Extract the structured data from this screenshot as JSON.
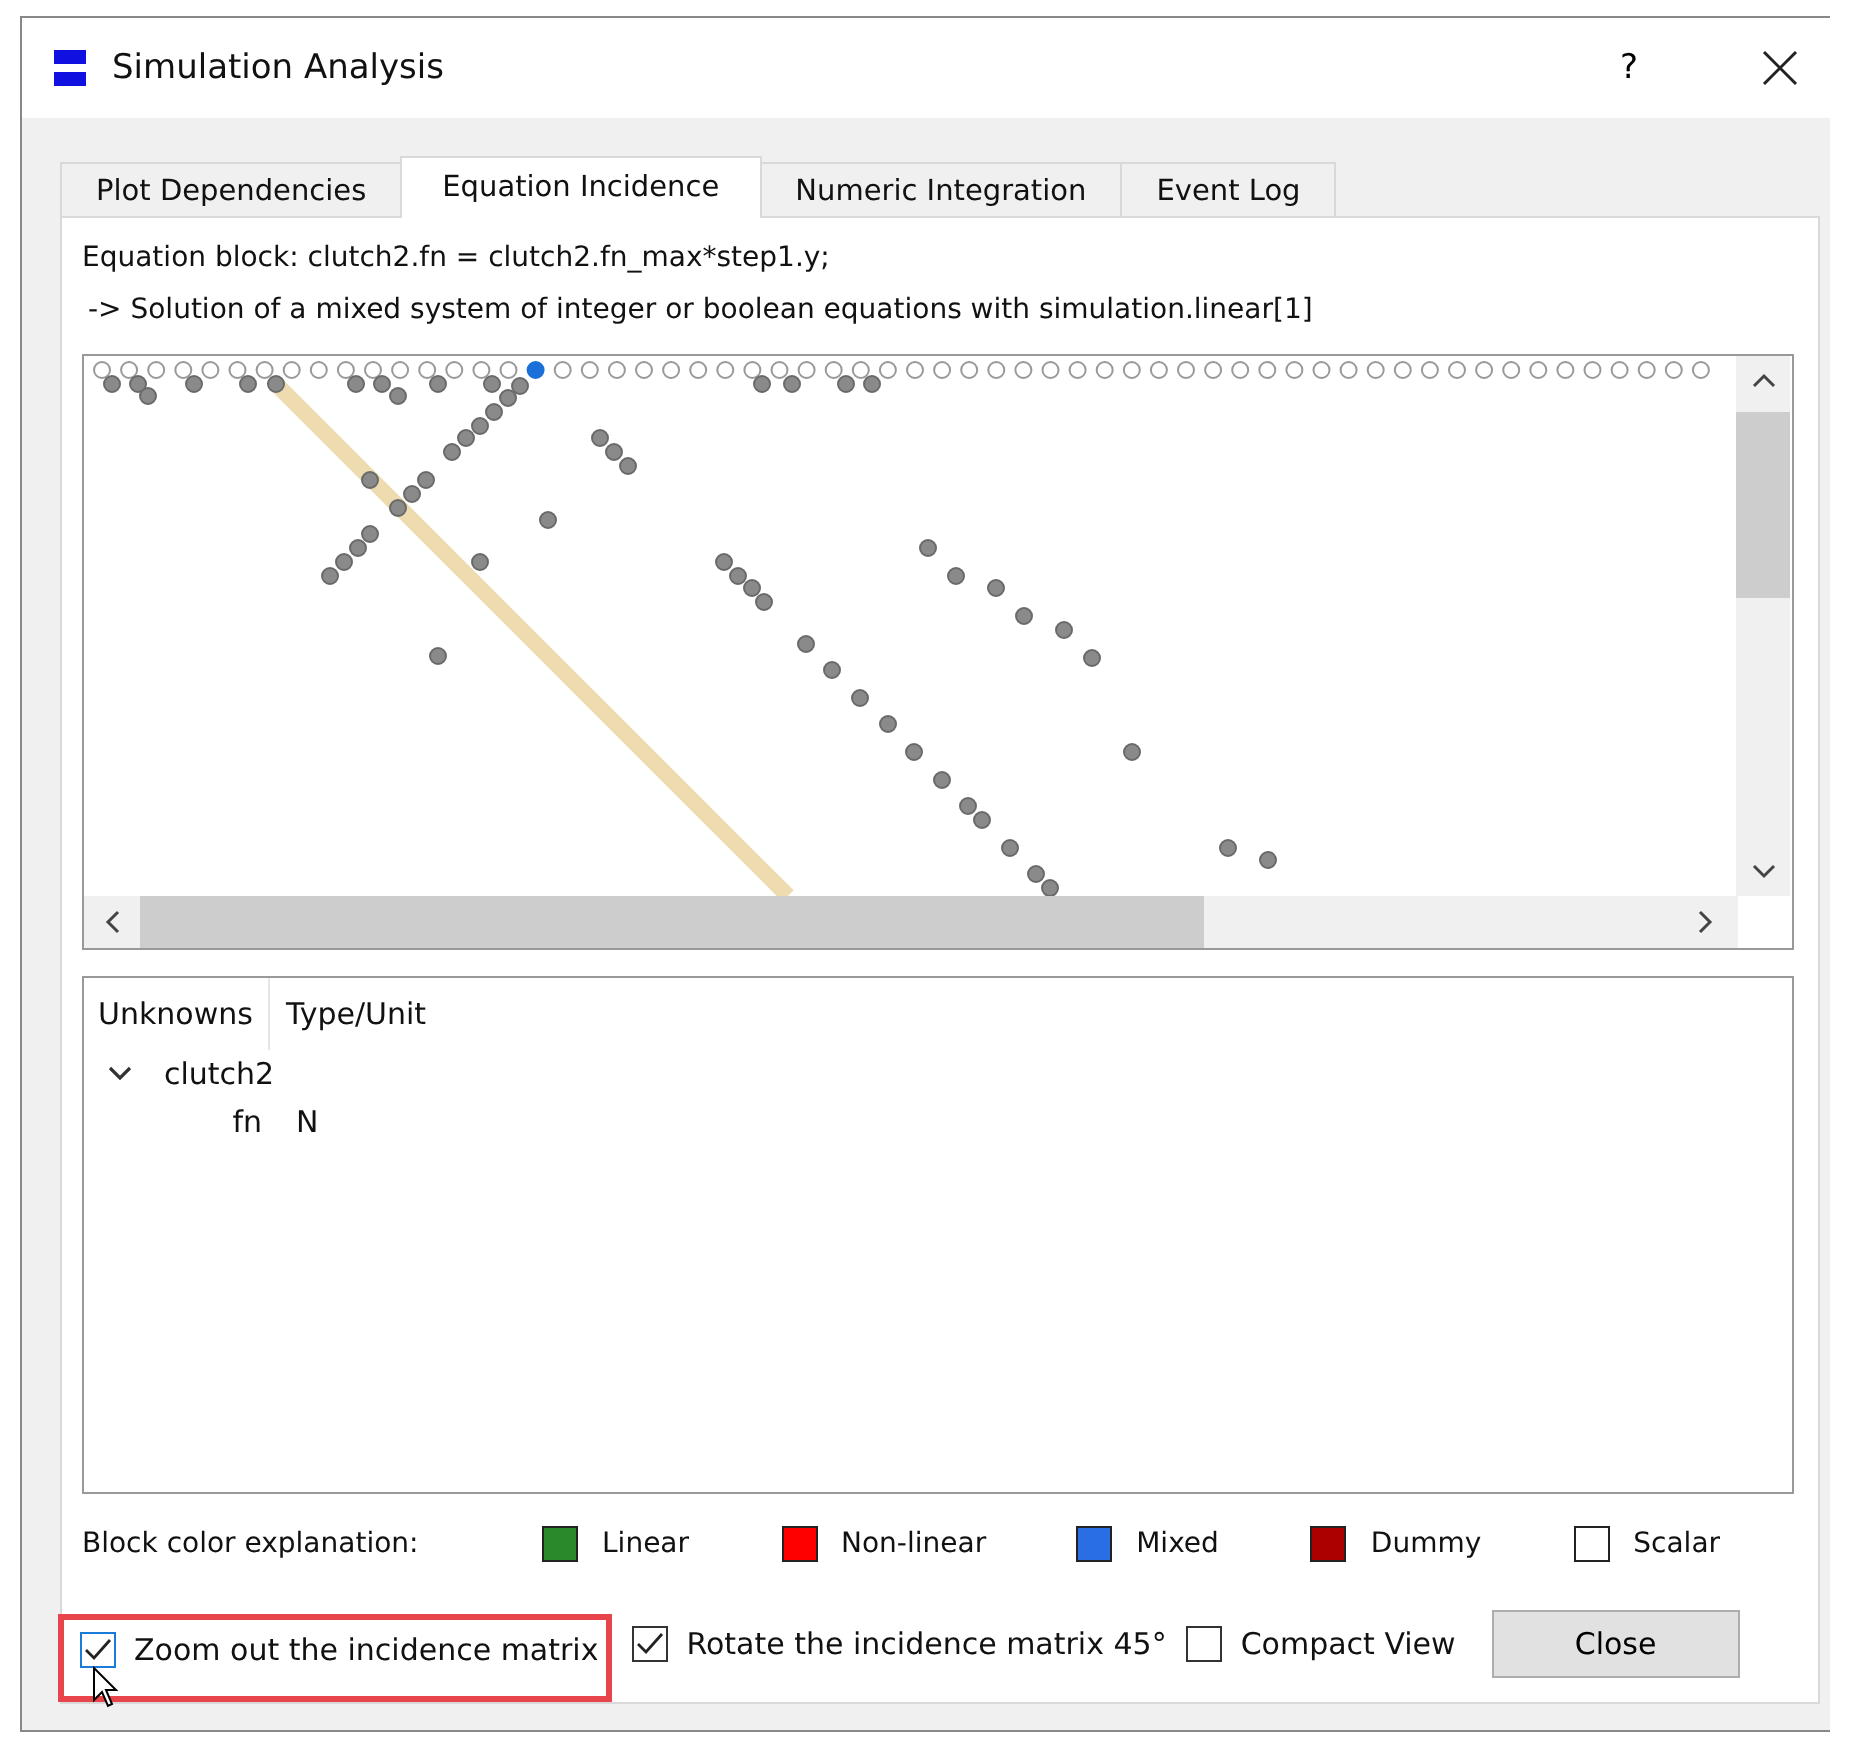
{
  "window": {
    "title": "Simulation Analysis",
    "help": "?"
  },
  "tabs": [
    {
      "label": "Plot Dependencies",
      "selected": false
    },
    {
      "label": "Equation Incidence",
      "selected": true
    },
    {
      "label": "Numeric Integration",
      "selected": false
    },
    {
      "label": "Event Log",
      "selected": false
    }
  ],
  "equation_block": "Equation block: clutch2.fn = clutch2.fn_max*step1.y;",
  "solution": "-> Solution of a mixed system of integer or boolean equations with simulation.linear[1]",
  "unknowns": {
    "columns": [
      "Unknowns",
      "Type/Unit"
    ],
    "rows": [
      {
        "name": "clutch2",
        "expanded": true,
        "children": [
          {
            "name": "fn",
            "type": "N"
          }
        ]
      }
    ]
  },
  "legend": {
    "label": "Block color explanation:",
    "items": [
      {
        "label": "Linear",
        "color": "#2a8a2a"
      },
      {
        "label": "Non-linear",
        "color": "#ff0000"
      },
      {
        "label": "Mixed",
        "color": "#2a6ee6"
      },
      {
        "label": "Dummy",
        "color": "#aa0000"
      },
      {
        "label": "Scalar",
        "color": "#ffffff"
      }
    ]
  },
  "options": [
    {
      "label": "Zoom out the incidence matrix",
      "checked": true,
      "highlighted": true
    },
    {
      "label": "Rotate the incidence matrix 45°",
      "checked": true,
      "highlighted": false
    },
    {
      "label": "Compact View",
      "checked": false,
      "highlighted": false
    }
  ],
  "close_button": "Close"
}
